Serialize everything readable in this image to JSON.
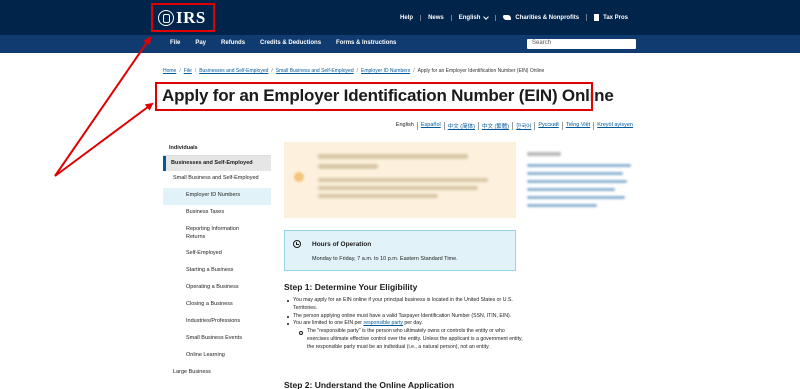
{
  "header": {
    "logo_text": "IRS",
    "utility": {
      "help": "Help",
      "news": "News",
      "language": "English",
      "charities": "Charities & Nonprofits",
      "tax_pros": "Tax Pros"
    }
  },
  "nav": {
    "items": [
      "File",
      "Pay",
      "Refunds",
      "Credits & Deductions",
      "Forms & Instructions"
    ],
    "search_placeholder": "Search"
  },
  "breadcrumb": {
    "items": [
      "Home",
      "File",
      "Businesses and Self-Employed",
      "Small Business and Self-Employed",
      "Employer ID Numbers"
    ],
    "current": "Apply for an Employer Identification Number (EIN) Online"
  },
  "page_title": "Apply for an Employer Identification Number (EIN) Online",
  "languages": [
    "English",
    "Español",
    "中文 (简体)",
    "中文 (繁體)",
    "한국어",
    "Русский",
    "Tiếng Việt",
    "Kreyòl ayisyen"
  ],
  "sidebar": {
    "individuals": "Individuals",
    "businesses": "Businesses and Self-Employed",
    "small_business": "Small Business and Self-Employed",
    "items": [
      "Employer ID Numbers",
      "Business Taxes",
      "Reporting Information Returns",
      "Self-Employed",
      "Starting a Business",
      "Operating a Business",
      "Closing a Business",
      "Industries/Professions",
      "Small Business Events",
      "Online Learning"
    ],
    "large_business": "Large Business"
  },
  "hours": {
    "title": "Hours of Operation",
    "text": "Monday to Friday, 7 a.m. to 10 p.m. Eastern Standard Time."
  },
  "step1": {
    "heading": "Step 1: Determine Your Eligibility",
    "b1": "You may apply for an EIN online if your principal business is located in the United States or U.S. Territories.",
    "b2": "The person applying online must have a valid Taxpayer Identification Number (SSN, ITIN, EIN).",
    "b3_pre": "You are limited to one EIN per ",
    "b3_link": "responsible party",
    "b3_post": " per day.",
    "sub": "The \"responsible party\" is the person who ultimately owns or controls the entity or who exercises ultimate effective control over the entity. Unless the applicant is a government entity, the responsible party must be an individual (i.e., a natural person), not an entity."
  },
  "step2": {
    "heading": "Step 2: Understand the Online Application"
  },
  "colors": {
    "topbar": "#00244a",
    "navbar": "#0f3b70",
    "annotation": "#e00000",
    "link": "#00599c"
  }
}
